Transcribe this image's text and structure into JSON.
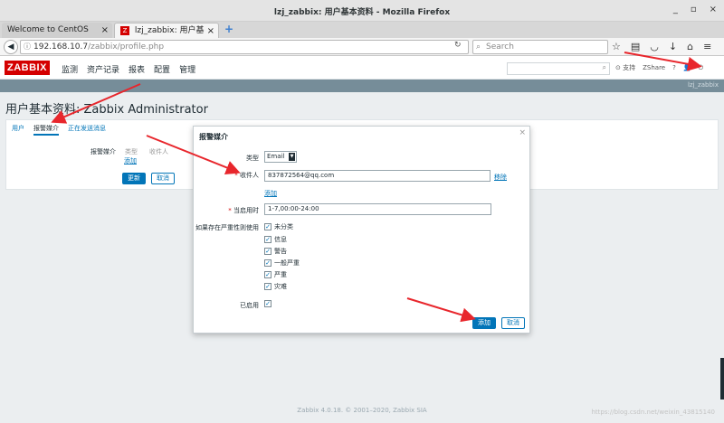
{
  "window": {
    "title": "lzj_zabbix: 用户基本资料 - Mozilla Firefox",
    "controls": [
      "_",
      "▫",
      "×"
    ]
  },
  "browser": {
    "tabs": [
      {
        "label": "Welcome to CentOS",
        "close": "×"
      },
      {
        "label": "lzj_zabbix: 用户基本...",
        "close": "×",
        "favicon": "Z"
      }
    ],
    "new_tab": "+",
    "url_host": "192.168.10.7",
    "url_path": "/zabbix/profile.php",
    "search_placeholder": "Search",
    "icons": [
      "star-icon",
      "reading-list-icon",
      "pocket-icon",
      "download-icon",
      "home-icon",
      "hamburger-menu-icon"
    ]
  },
  "zabbix": {
    "logo": "ZABBIX",
    "menu": [
      "监测",
      "资产记录",
      "报表",
      "配置",
      "管理"
    ],
    "support": "支持",
    "share": "Share",
    "help": "?",
    "user_band": "lzj_zabbix",
    "accent": "#d40000"
  },
  "page": {
    "title": "用户基本资料: Zabbix Administrator",
    "tabs": [
      "用户",
      "报警媒介",
      "正在发送消息"
    ],
    "media_label": "报警媒介",
    "col_type": "类型",
    "col_recipient": "收件人",
    "add_link": "添加",
    "update_btn": "更新",
    "cancel_btn": "取消"
  },
  "modal": {
    "title": "报警媒介",
    "close": "×",
    "type_label": "类型",
    "type_value": "Email",
    "recipient_label": "收件人",
    "recipient_value": "837872564@qq.com",
    "remove_link": "移除",
    "add_link": "添加",
    "when_label": "当启用时",
    "when_value": "1-7,00:00-24:00",
    "severity_label": "如果存在严重性则使用",
    "severities": [
      "未分类",
      "信息",
      "警告",
      "一般严重",
      "严重",
      "灾难"
    ],
    "enabled_label": "已启用",
    "add_btn": "添加",
    "cancel_btn": "取消"
  },
  "footer": "Zabbix 4.0.18. © 2001–2020, Zabbix SIA",
  "watermark": "https://blog.csdn.net/weixin_43815140"
}
